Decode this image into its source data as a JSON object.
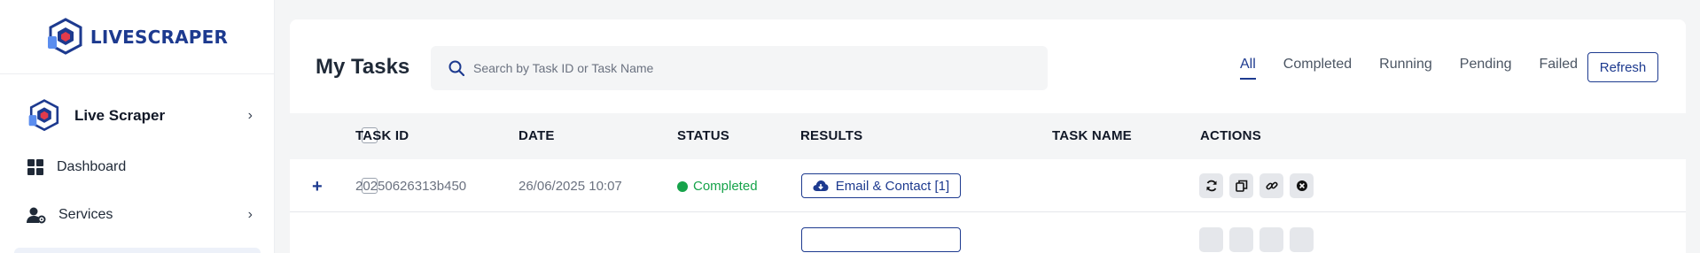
{
  "brand": {
    "name": "LIVESCRAPER",
    "logo_icon": "cube-logo-icon"
  },
  "sidebar": {
    "items": [
      {
        "label": "Live Scraper",
        "icon": "cube-logo-icon",
        "has_chevron": true
      },
      {
        "label": "Dashboard",
        "icon": "grid-icon",
        "has_chevron": false
      },
      {
        "label": "Services",
        "icon": "user-gear-icon",
        "has_chevron": true
      }
    ],
    "chevron": "›"
  },
  "header": {
    "title": "My Tasks",
    "search_placeholder": "Search by Task ID or Task Name",
    "filters": [
      "All",
      "Completed",
      "Running",
      "Pending",
      "Failed"
    ],
    "active_filter": "All",
    "refresh_label": "Refresh"
  },
  "table": {
    "columns": [
      "TASK ID",
      "DATE",
      "STATUS",
      "RESULTS",
      "TASK NAME",
      "ACTIONS"
    ],
    "rows": [
      {
        "expand": "+",
        "task_id": "20250626313b450",
        "date": "26/06/2025 10:07",
        "status": "Completed",
        "result_label": "Email & Contact [1]",
        "task_name": ""
      }
    ]
  },
  "colors": {
    "accent": "#1d3a8f",
    "success": "#16a34a",
    "muted": "#6b7280"
  }
}
